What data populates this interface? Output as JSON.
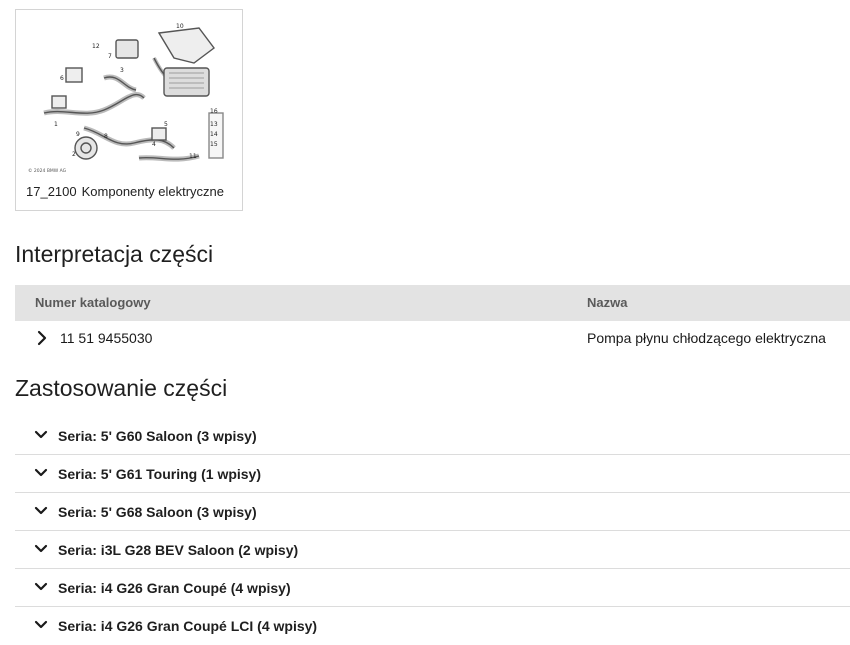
{
  "diagram_card": {
    "code": "17_2100",
    "title": "Komponenty elektryczne",
    "image_copyright": "© 2024 BMW AG",
    "callouts": [
      "1",
      "2",
      "3",
      "4",
      "5",
      "6",
      "7",
      "8",
      "9",
      "10",
      "11",
      "12",
      "13",
      "14",
      "15",
      "16"
    ]
  },
  "interpretation": {
    "title": "Interpretacja części",
    "columns": {
      "number": "Numer katalogowy",
      "name": "Nazwa"
    },
    "rows": [
      {
        "number": "11 51 9455030",
        "name": "Pompa płynu chłodzącego elektryczna"
      }
    ]
  },
  "usage": {
    "title": "Zastosowanie części",
    "series": [
      {
        "label": "Seria: 5' G60 Saloon (3 wpisy)"
      },
      {
        "label": "Seria: 5' G61 Touring (1 wpisy)"
      },
      {
        "label": "Seria: 5' G68 Saloon (3 wpisy)"
      },
      {
        "label": "Seria: i3L G28 BEV Saloon (2 wpisy)"
      },
      {
        "label": "Seria: i4 G26 Gran Coupé (4 wpisy)"
      },
      {
        "label": "Seria: i4 G26 Gran Coupé LCI (4 wpisy)"
      }
    ]
  },
  "colors": {
    "header_bg": "#e3e3e3",
    "header_text": "#5a5a5a",
    "divider": "#dcdcdc"
  }
}
